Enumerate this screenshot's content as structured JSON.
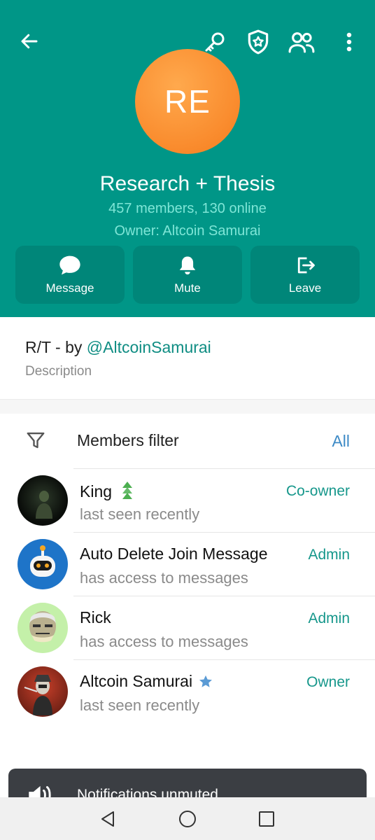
{
  "header": {
    "avatar_initials": "RE",
    "title": "Research + Thesis",
    "members_line": "457 members, 130 online",
    "owner_line": "Owner: Altcoin Samurai",
    "icons": [
      "back-arrow-icon",
      "key-icon",
      "shield-star-icon",
      "people-icon",
      "more-vertical-icon"
    ],
    "accent_color": "#009687"
  },
  "actions": [
    {
      "label": "Message",
      "icon": "chat-bubble-icon"
    },
    {
      "label": "Mute",
      "icon": "bell-icon"
    },
    {
      "label": "Leave",
      "icon": "exit-icon"
    }
  ],
  "description": {
    "prefix": "R/T - by ",
    "link": "@AltcoinSamurai",
    "label": "Description"
  },
  "filter": {
    "label": "Members filter",
    "value": "All",
    "icon": "filter-icon"
  },
  "members": [
    {
      "name": "King",
      "badge": "tree-badge-icon",
      "status": "last seen recently",
      "role": "Co-owner"
    },
    {
      "name": "Auto Delete Join Message",
      "status": "has access to messages",
      "role": "Admin"
    },
    {
      "name": "Rick",
      "status": "has access to messages",
      "role": "Admin"
    },
    {
      "name": "Altcoin Samurai",
      "badge": "star-badge-icon",
      "status": "last seen recently",
      "role": "Owner"
    }
  ],
  "toast": {
    "text": "Notifications unmuted",
    "icon": "speaker-icon"
  },
  "navbar": {
    "icons": [
      "nav-back-icon",
      "nav-home-icon",
      "nav-recents-icon"
    ]
  }
}
